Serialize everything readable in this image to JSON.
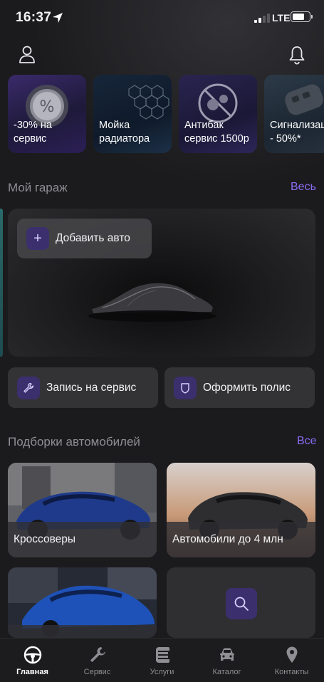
{
  "status_bar": {
    "time": "16:37",
    "network": "LTE",
    "battery_level": 0.75
  },
  "promos": [
    {
      "label": "-30% на\nсервис"
    },
    {
      "label": "Мойка\nрадиатора"
    },
    {
      "label": "Антибак\nсервис 1500р"
    },
    {
      "label": "Сигнализац\n- 50%*"
    }
  ],
  "garage": {
    "title": "Мой гараж",
    "link": "Весь",
    "add_car": "Добавить авто"
  },
  "actions": {
    "service": "Запись на сервис",
    "policy": "Оформить полис"
  },
  "collections": {
    "title": "Подборки автомобилей",
    "link": "Все",
    "items": [
      {
        "label": "Кроссоверы"
      },
      {
        "label": "Автомобили до 4 млн"
      }
    ]
  },
  "tabs": [
    {
      "label": "Главная",
      "icon": "steering-wheel-icon",
      "active": true
    },
    {
      "label": "Сервис",
      "icon": "wrench-icon",
      "active": false
    },
    {
      "label": "Услуги",
      "icon": "services-icon",
      "active": false
    },
    {
      "label": "Каталог",
      "icon": "car-icon",
      "active": false
    },
    {
      "label": "Контакты",
      "icon": "location-pin-icon",
      "active": false
    }
  ],
  "colors": {
    "accent": "#8b6cf6",
    "icon_bg": "#3b2f6e",
    "background": "#1b1b1d"
  }
}
